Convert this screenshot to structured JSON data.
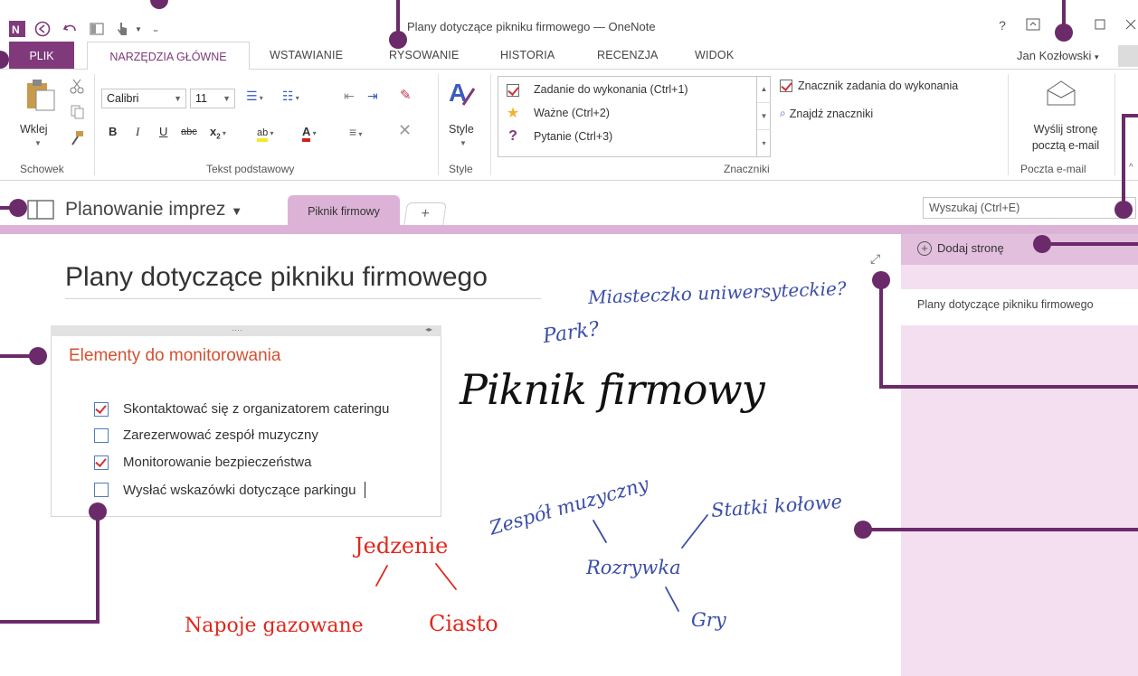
{
  "window": {
    "title": "Plany dotyczące pikniku firmowego — OneNote",
    "help": "?",
    "user": "Jan Kozłowski"
  },
  "tabs": [
    {
      "label": "PLIK"
    },
    {
      "label": "NARZĘDZIA GŁÓWNE"
    },
    {
      "label": "WSTAWIANIE"
    },
    {
      "label": "RYSOWANIE"
    },
    {
      "label": "HISTORIA"
    },
    {
      "label": "RECENZJA"
    },
    {
      "label": "WIDOK"
    }
  ],
  "ribbon": {
    "clipboard": {
      "paste": "Wklej",
      "group": "Schowek"
    },
    "basic_text": {
      "font": "Calibri",
      "size": "11",
      "group": "Tekst podstawowy"
    },
    "styles": {
      "label": "Style",
      "group": "Style"
    },
    "tags": {
      "items": [
        {
          "label": "Zadanie do wykonania (Ctrl+1)"
        },
        {
          "label": "Ważne (Ctrl+2)"
        },
        {
          "label": "Pytanie (Ctrl+3)"
        }
      ],
      "todo_tag": "Znacznik zadania do wykonania",
      "find_tags": "Znajdź znaczniki",
      "group": "Znaczniki"
    },
    "email": {
      "line1": "Wyślij stronę",
      "line2": "pocztą e-mail",
      "group": "Poczta e-mail"
    }
  },
  "notebook": {
    "name": "Planowanie imprez",
    "section": "Piknik firmowy",
    "add_section": "+",
    "search_placeholder": "Wyszukaj (Ctrl+E)"
  },
  "pages": {
    "add_page": "Dodaj stronę",
    "items": [
      "Plany dotyczące pikniku firmowego"
    ]
  },
  "page": {
    "title": "Plany dotyczące pikniku firmowego",
    "list_title": "Elementy do monitorowania",
    "todos": [
      {
        "label": "Skontaktować się z organizatorem cateringu",
        "checked": true
      },
      {
        "label": "Zarezerwować zespół muzyczny",
        "checked": false
      },
      {
        "label": "Monitorowanie bezpieczeństwa",
        "checked": true
      },
      {
        "label": "Wysłać wskazówki dotyczące parkingu",
        "checked": false
      }
    ],
    "ink": {
      "campus": "Miasteczko uniwersyteckie?",
      "park": "Park?",
      "headline": "Piknik firmowy",
      "band": "Zespół muzyczny",
      "carousel": "Statki kołowe",
      "entertainment": "Rozrywka",
      "games": "Gry",
      "food": "Jedzenie",
      "soda": "Napoje gazowane",
      "cake": "Ciasto"
    }
  },
  "colors": {
    "accent": "#80397B",
    "section": "#dcb3d6",
    "callout": "#6b2b6a",
    "ink_blue": "#3b4ea8",
    "ink_red": "#e0281d"
  }
}
